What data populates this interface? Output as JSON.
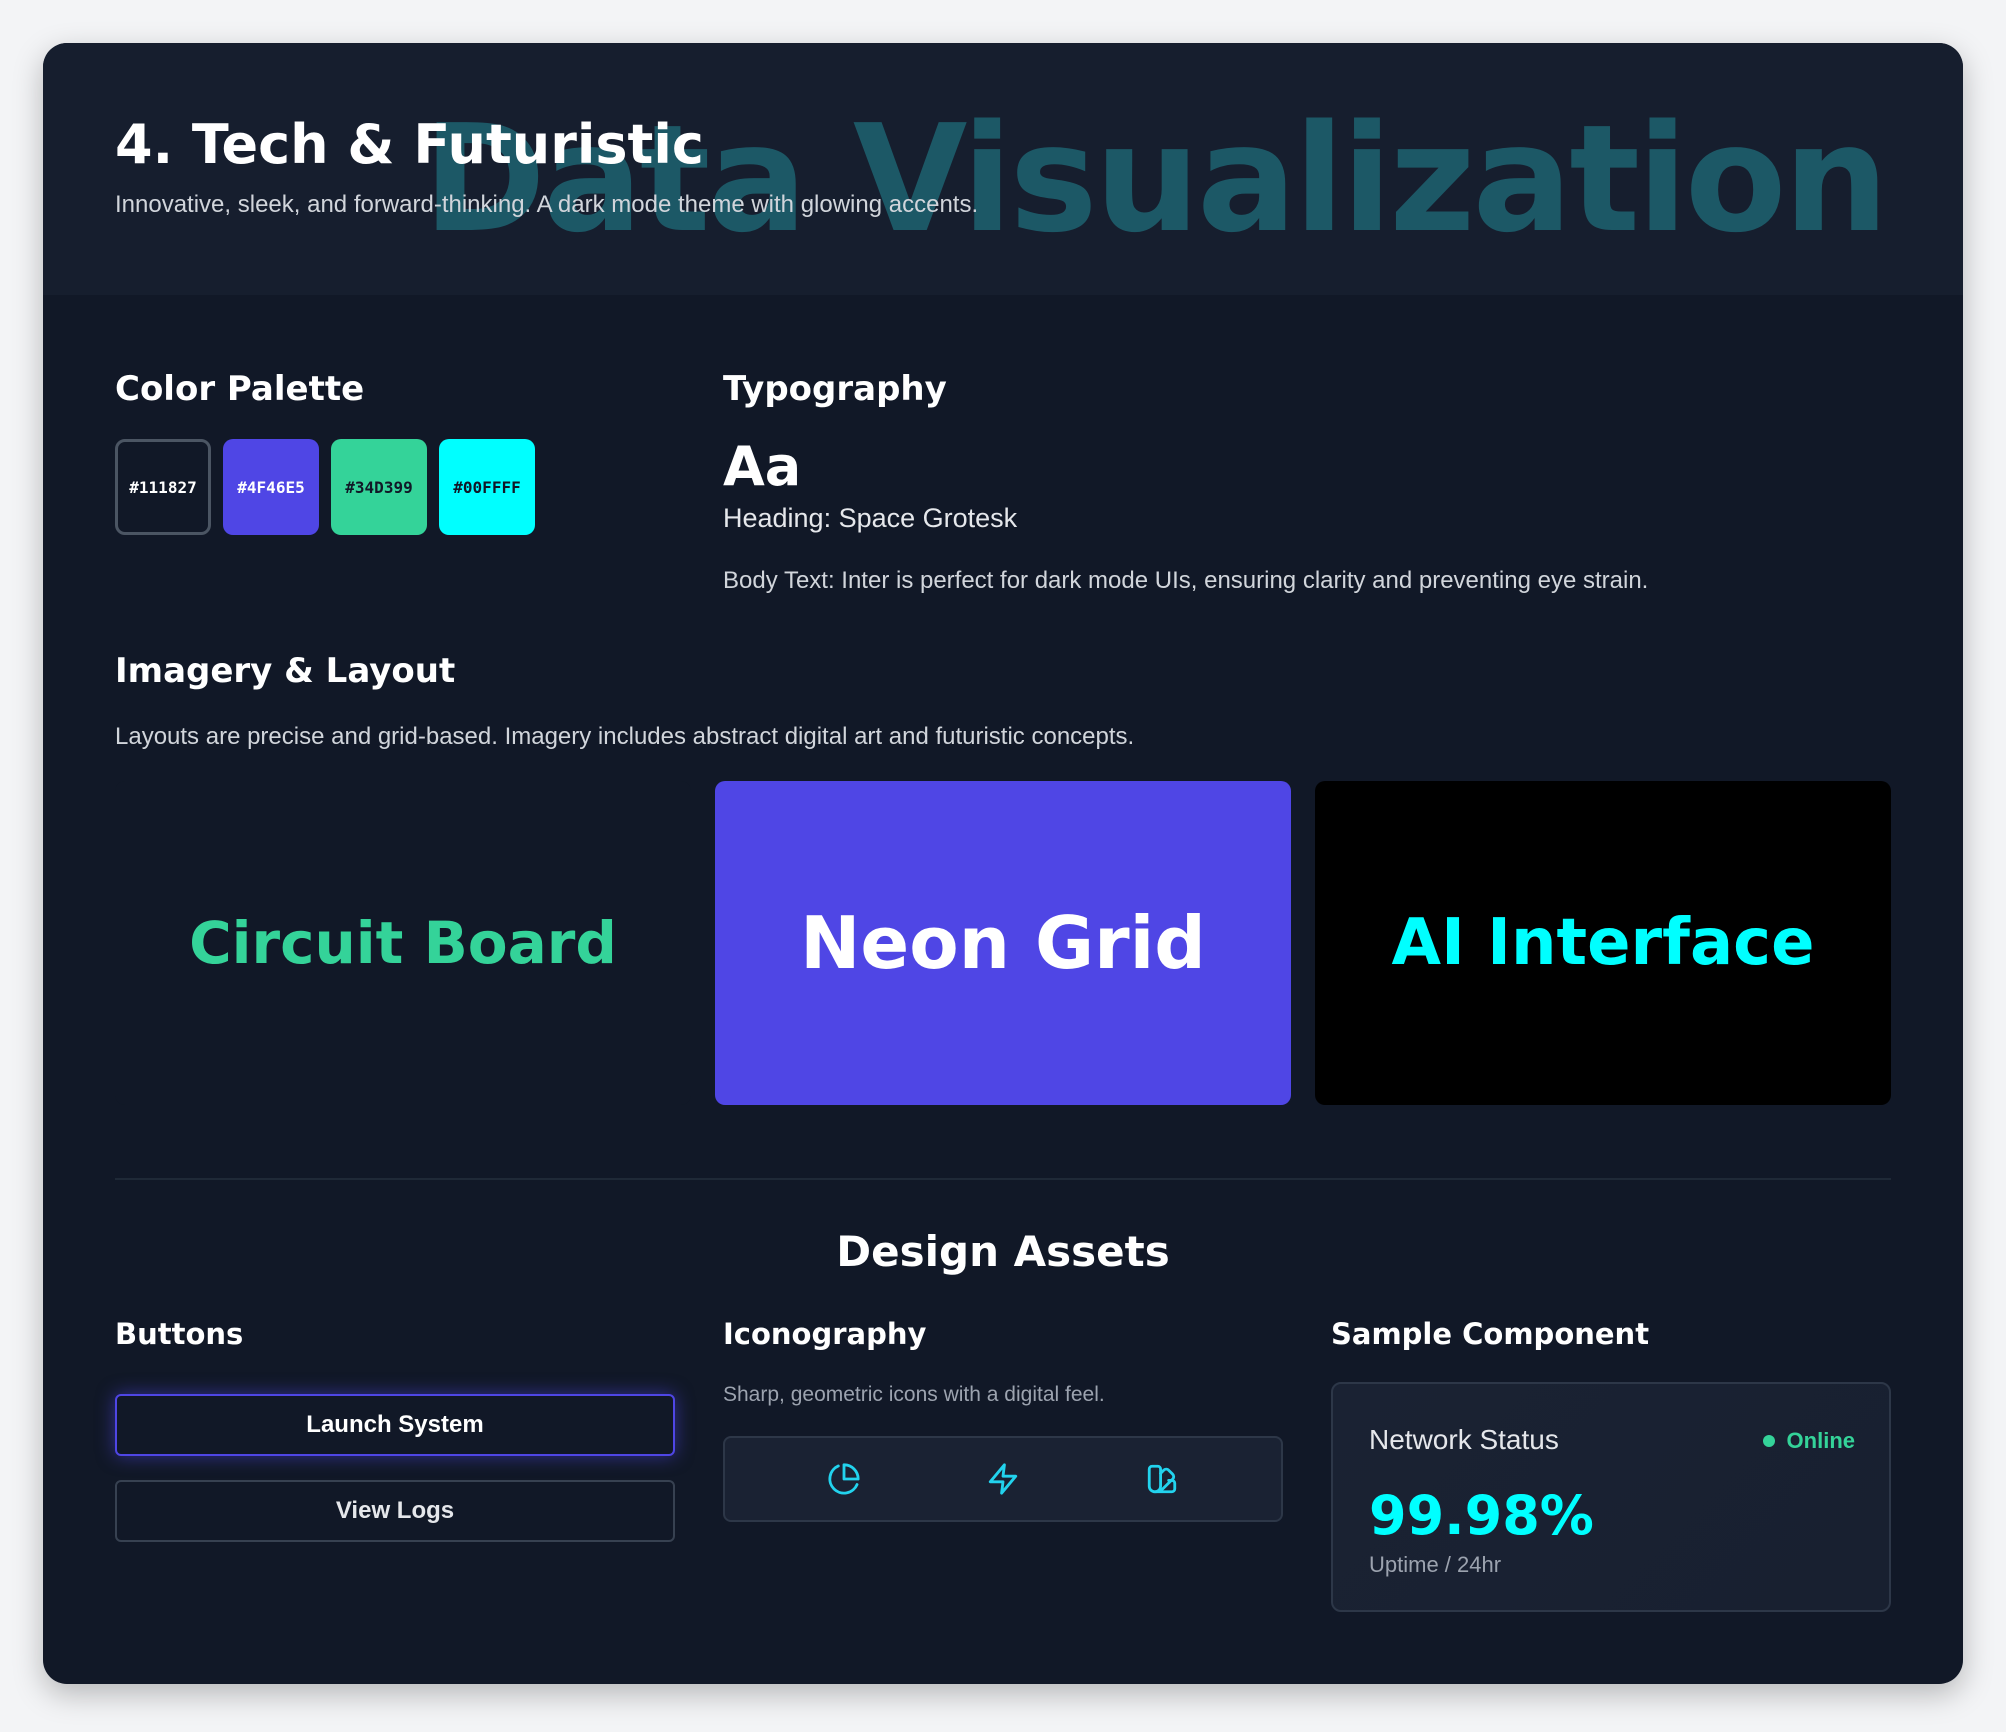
{
  "header": {
    "watermark": "Data Visualization",
    "title": "4. Tech & Futuristic",
    "subtitle": "Innovative, sleek, and forward-thinking. A dark mode theme with glowing accents."
  },
  "palette": {
    "heading": "Color Palette",
    "swatches": [
      {
        "hex": "#111827",
        "text_color": "#ffffff"
      },
      {
        "hex": "#4F46E5",
        "text_color": "#ffffff"
      },
      {
        "hex": "#34D399",
        "text_color": "#111827"
      },
      {
        "hex": "#00FFFF",
        "text_color": "#111827"
      }
    ]
  },
  "typography": {
    "heading": "Typography",
    "sample": "Aa",
    "heading_font": "Heading: Space Grotesk",
    "body_font": "Body Text: Inter is perfect for dark mode UIs, ensuring clarity and preventing eye strain."
  },
  "imagery": {
    "heading": "Imagery & Layout",
    "description": "Layouts are precise and grid-based. Imagery includes abstract digital art and futuristic concepts.",
    "tiles": [
      {
        "label": "Circuit Board",
        "bg": "#111827",
        "fg": "#34d399"
      },
      {
        "label": "Neon Grid",
        "bg": "#4f46e5",
        "fg": "#ffffff"
      },
      {
        "label": "AI Interface",
        "bg": "#000000",
        "fg": "#00ffff"
      }
    ]
  },
  "assets": {
    "heading": "Design Assets",
    "buttons": {
      "heading": "Buttons",
      "primary": "Launch System",
      "secondary": "View Logs"
    },
    "iconography": {
      "heading": "Iconography",
      "description": "Sharp, geometric icons with a digital feel.",
      "icons": [
        "pie-chart-icon",
        "lightning-bolt-icon",
        "swatch-book-icon"
      ],
      "icon_color": "#22d3ee"
    },
    "component": {
      "heading": "Sample Component",
      "title": "Network Status",
      "status": "Online",
      "value": "99.98%",
      "label": "Uptime / 24hr"
    }
  },
  "colors": {
    "accent": "#4F46E5",
    "success": "#34D399",
    "glow": "#00FFFF",
    "background": "#111827"
  }
}
